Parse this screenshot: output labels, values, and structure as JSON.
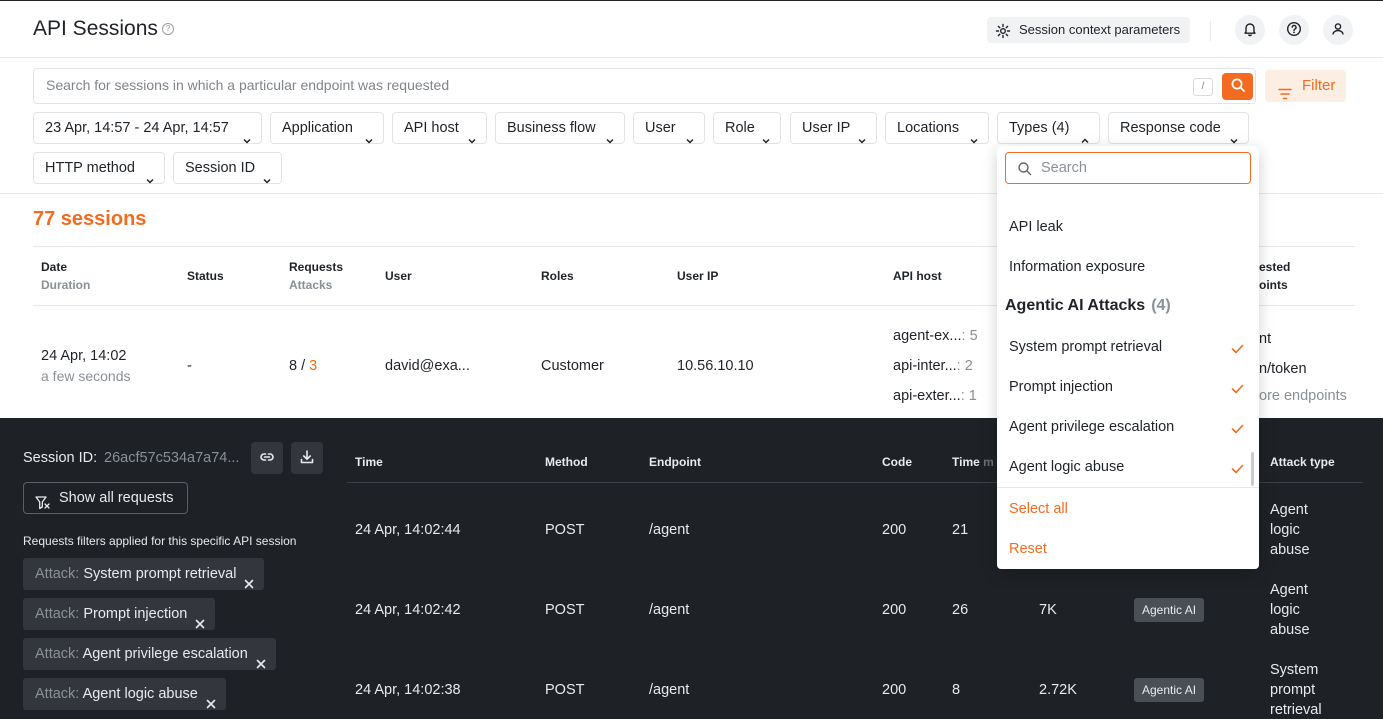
{
  "header": {
    "title": "API Sessions",
    "info_glyph": "?",
    "context_button": "Session context parameters"
  },
  "search": {
    "placeholder": "Search for sessions in which a particular endpoint was requested",
    "shortcut": "/",
    "filter_label": "Filter"
  },
  "filters": {
    "date": "23 Apr, 14:57 - 24 Apr, 14:57",
    "application": "Application",
    "api_host": "API host",
    "business_flow": "Business flow",
    "user": "User",
    "role": "Role",
    "user_ip": "User IP",
    "locations": "Locations",
    "types": "Types (4)",
    "response_code": "Response code",
    "http_method": "HTTP method",
    "session_id": "Session ID"
  },
  "sessions": {
    "count": "77 sessions",
    "columns": {
      "date": "Date",
      "duration": "Duration",
      "status": "Status",
      "requests": "Requests",
      "attacks": "Attacks",
      "user": "User",
      "roles": "Roles",
      "user_ip": "User IP",
      "api_host": "API host",
      "requested_endpoints_1": "ested",
      "requested_endpoints_2": "oints"
    },
    "row": {
      "date": "24 Apr, 14:02",
      "duration": "a few seconds",
      "status": "-",
      "requests": "8",
      "requests_sep": " / ",
      "attacks": "3",
      "user": "david@exa...",
      "role": "Customer",
      "ip": "10.56.10.10",
      "hosts": [
        {
          "name": "agent-ex...",
          "count": ": 5"
        },
        {
          "name": "api-inter...",
          "count": ": 2"
        },
        {
          "name": "api-exter...",
          "count": ": 1"
        }
      ],
      "endpoint_1": "nt",
      "endpoint_2": "n/token",
      "endpoint_more": "ore endpoints"
    }
  },
  "session_panel": {
    "id_label": "Session ID:",
    "id_value": "26acf57c534a7a74...",
    "show_all": "Show all requests",
    "note": "Requests filters applied for this specific API session",
    "tags": [
      {
        "key": "Attack:",
        "value": "System prompt retrieval"
      },
      {
        "key": "Attack:",
        "value": "Prompt injection"
      },
      {
        "key": "Attack:",
        "value": "Agent privilege escalation"
      },
      {
        "key": "Attack:",
        "value": "Agent logic abuse"
      }
    ],
    "columns": {
      "time": "Time",
      "method": "Method",
      "endpoint": "Endpoint",
      "code": "Code",
      "time_ms": "Time",
      "time_ms_suffix": "m",
      "attack_type": "Attack type"
    },
    "rows": [
      {
        "time": "24 Apr, 14:02:44",
        "method": "POST",
        "endpoint": "/agent",
        "code": "200",
        "ms": "21",
        "size": "",
        "badge": "",
        "attack": [
          "Agent",
          "logic",
          "abuse"
        ]
      },
      {
        "time": "24 Apr, 14:02:42",
        "method": "POST",
        "endpoint": "/agent",
        "code": "200",
        "ms": "26",
        "size": "7K",
        "badge": "Agentic AI",
        "attack": [
          "Agent",
          "logic",
          "abuse"
        ]
      },
      {
        "time": "24 Apr, 14:02:38",
        "method": "POST",
        "endpoint": "/agent",
        "code": "200",
        "ms": "8",
        "size": "2.72K",
        "badge": "Agentic AI",
        "attack": [
          "System",
          "prompt",
          "retrieval"
        ]
      }
    ]
  },
  "dropdown": {
    "search_placeholder": "Search",
    "items_top": [
      "API leak",
      "Information exposure"
    ],
    "group_name": "Agentic AI Attacks",
    "group_count": "(4)",
    "group_items": [
      "System prompt retrieval",
      "Prompt injection",
      "Agent privilege escalation",
      "Agent logic abuse"
    ],
    "select_all": "Select all",
    "reset": "Reset"
  },
  "colors": {
    "accent": "#f26b21",
    "dark_panel": "#1e2125"
  }
}
